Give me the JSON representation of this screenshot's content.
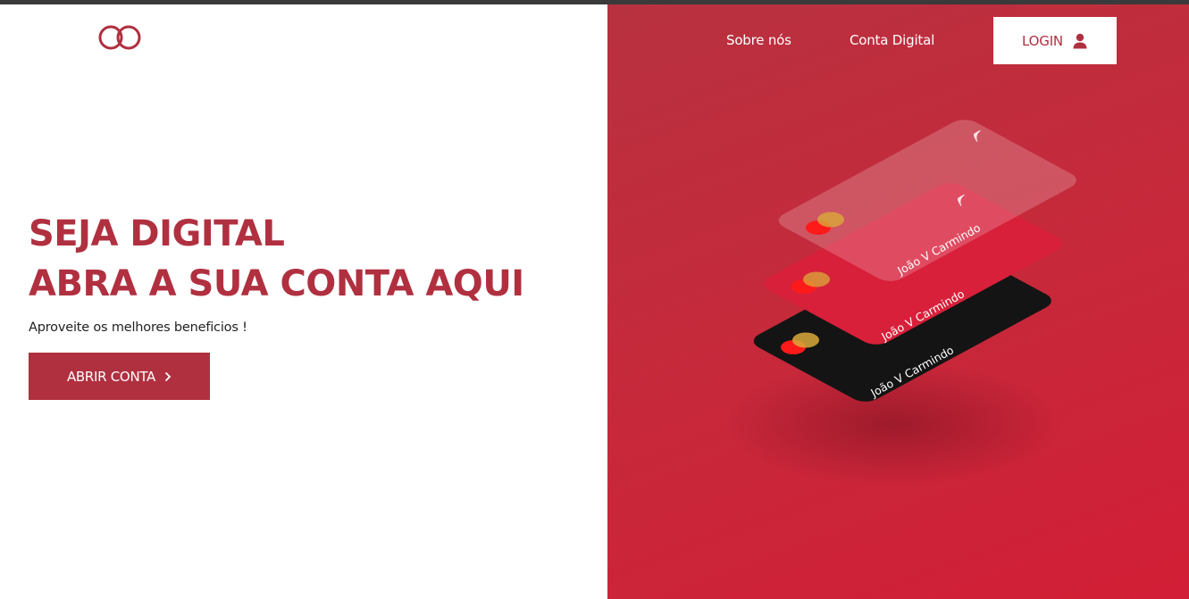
{
  "header": {
    "logo_icon": "infinity-logo-icon",
    "nav": [
      {
        "label": "Sobre nós"
      },
      {
        "label": "Conta Digital"
      }
    ],
    "login_label": "LOGIN",
    "login_icon": "user-icon"
  },
  "hero": {
    "title_line1": "SEJA DIGITAL",
    "title_line2": "ABRA A SUA CONTA AQUI",
    "subtitle": "Aproveite os melhores beneficios !",
    "cta_label": "ABRIR CONTA",
    "cta_icon": "chevron-right-icon"
  },
  "cards": [
    {
      "holder": "João V Carmindo",
      "style": "glass"
    },
    {
      "holder": "João V Carmindo",
      "style": "red"
    },
    {
      "holder": "João V Carmindo",
      "style": "black"
    }
  ],
  "colors": {
    "brand": "#b03040",
    "panel_start": "#b8313f",
    "panel_end": "#d21e36",
    "card_black": "#141414"
  }
}
